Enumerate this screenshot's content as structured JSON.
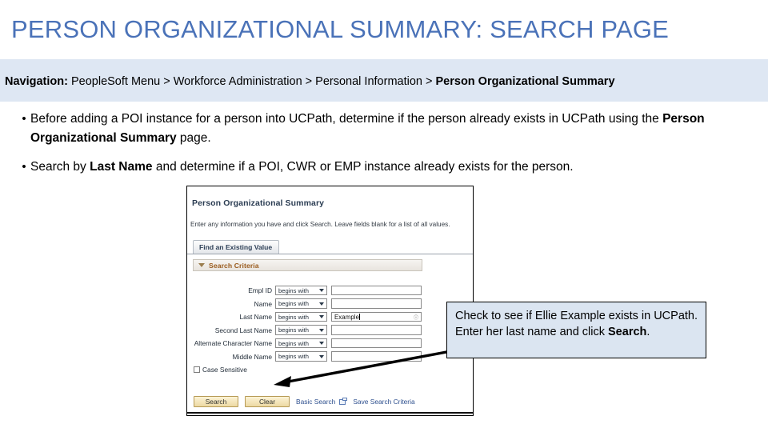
{
  "slide": {
    "title": "PERSON ORGANIZATIONAL SUMMARY: SEARCH PAGE",
    "title_color": "#4a72b8",
    "navigation": {
      "label": "Navigation:",
      "path_plain": " PeopleSoft Menu > Workforce Administration > Personal Information > ",
      "path_bold": "Person Organizational Summary",
      "band_color": "#dee7f3"
    },
    "bullets": [
      {
        "marker": "•",
        "part1": "Before adding a POI instance for a person into UCPath, determine if the person already exists in UCPath using the ",
        "bold": "Person Organizational Summary",
        "part2": " page."
      },
      {
        "marker": "•",
        "part1": "Search by ",
        "bold": "Last Name",
        "part2": " and determine if a POI, CWR or EMP instance already exists for the person."
      }
    ]
  },
  "peoplesoft": {
    "page_title": "Person Organizational Summary",
    "instructions": "Enter any information you have and click Search. Leave fields blank for a list of all values.",
    "tab_label": "Find an Existing Value",
    "section_header": "Search Criteria",
    "fields": [
      {
        "label": "Empl ID",
        "operator": "begins with",
        "value": "",
        "has_caret": false,
        "has_lookup": false
      },
      {
        "label": "Name",
        "operator": "begins with",
        "value": "",
        "has_caret": false,
        "has_lookup": false
      },
      {
        "label": "Last Name",
        "operator": "begins with",
        "value": "Example",
        "has_caret": true,
        "has_lookup": true
      },
      {
        "label": "Second Last Name",
        "operator": "begins with",
        "value": "",
        "has_caret": false,
        "has_lookup": false
      },
      {
        "label": "Alternate Character Name",
        "operator": "begins with",
        "value": "",
        "has_caret": false,
        "has_lookup": false
      },
      {
        "label": "Middle Name",
        "operator": "begins with",
        "value": "",
        "has_caret": false,
        "has_lookup": false
      }
    ],
    "case_sensitive_label": "Case Sensitive",
    "case_sensitive_checked": false,
    "search_button": "Search",
    "clear_button": "Clear",
    "basic_search_link": "Basic Search",
    "save_search_link": "Save Search Criteria",
    "lookup_glyph": "ⓘ"
  },
  "callout": {
    "part1": "Check to see if Ellie Example exists in UCPath. Enter her last name and click ",
    "bold": "Search",
    "part2": ".",
    "background": "#dbe5f1",
    "border": "#000000"
  }
}
